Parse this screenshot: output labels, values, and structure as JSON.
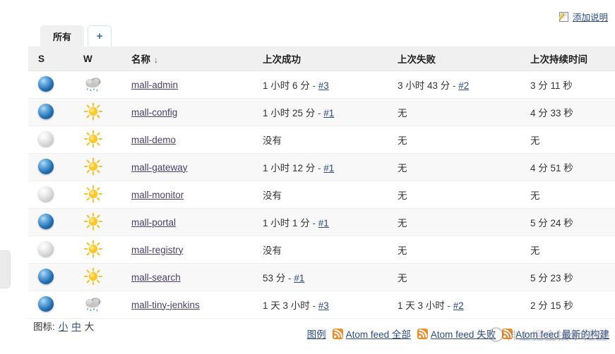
{
  "header": {
    "add_description": "添加说明",
    "add_description_icon": "pencil-edit-icon"
  },
  "tabs": {
    "items": [
      {
        "label": "所有",
        "active": true
      },
      {
        "label": "+",
        "active": false
      }
    ]
  },
  "table": {
    "columns": {
      "status": "S",
      "weather": "W",
      "name": "名称",
      "sort_arrow": "↓",
      "last_success": "上次成功",
      "last_failure": "上次失败",
      "last_duration": "上次持续时间",
      "actions": ""
    },
    "rows": [
      {
        "status": "blue",
        "status_icon": "status-ball-blue",
        "weather": "rainy",
        "weather_icon": "weather-rainy-icon",
        "name": "mall-admin",
        "last_success_text": "1 小时 6 分",
        "last_success_sep": "-",
        "last_success_build": "#3",
        "last_failure_text": "3 小时 43 分",
        "last_failure_sep": "-",
        "last_failure_build": "#2",
        "last_duration": "3 分 11 秒",
        "action_icon": "build-now-icon"
      },
      {
        "status": "blue",
        "status_icon": "status-ball-blue",
        "weather": "sunny",
        "weather_icon": "weather-sunny-icon",
        "name": "mall-config",
        "last_success_text": "1 小时 25 分",
        "last_success_sep": "-",
        "last_success_build": "#1",
        "last_failure_text": "无",
        "last_failure_sep": "",
        "last_failure_build": "",
        "last_duration": "4 分 33 秒",
        "action_icon": "build-now-icon"
      },
      {
        "status": "grey",
        "status_icon": "status-ball-grey",
        "weather": "sunny",
        "weather_icon": "weather-sunny-icon",
        "name": "mall-demo",
        "last_success_text": "没有",
        "last_success_sep": "",
        "last_success_build": "",
        "last_failure_text": "无",
        "last_failure_sep": "",
        "last_failure_build": "",
        "last_duration": "无",
        "action_icon": "build-now-icon"
      },
      {
        "status": "blue",
        "status_icon": "status-ball-blue",
        "weather": "sunny",
        "weather_icon": "weather-sunny-icon",
        "name": "mall-gateway",
        "last_success_text": "1 小时 12 分",
        "last_success_sep": "-",
        "last_success_build": "#1",
        "last_failure_text": "无",
        "last_failure_sep": "",
        "last_failure_build": "",
        "last_duration": "4 分 51 秒",
        "action_icon": "build-now-icon"
      },
      {
        "status": "grey",
        "status_icon": "status-ball-grey",
        "weather": "sunny",
        "weather_icon": "weather-sunny-icon",
        "name": "mall-monitor",
        "last_success_text": "没有",
        "last_success_sep": "",
        "last_success_build": "",
        "last_failure_text": "无",
        "last_failure_sep": "",
        "last_failure_build": "",
        "last_duration": "无",
        "action_icon": "build-now-icon"
      },
      {
        "status": "blue",
        "status_icon": "status-ball-blue",
        "weather": "sunny",
        "weather_icon": "weather-sunny-icon",
        "name": "mall-portal",
        "last_success_text": "1 小时 1 分",
        "last_success_sep": "-",
        "last_success_build": "#1",
        "last_failure_text": "无",
        "last_failure_sep": "",
        "last_failure_build": "",
        "last_duration": "5 分 24 秒",
        "action_icon": "build-now-icon"
      },
      {
        "status": "grey",
        "status_icon": "status-ball-grey",
        "weather": "sunny",
        "weather_icon": "weather-sunny-icon",
        "name": "mall-registry",
        "last_success_text": "没有",
        "last_success_sep": "",
        "last_success_build": "",
        "last_failure_text": "无",
        "last_failure_sep": "",
        "last_failure_build": "",
        "last_duration": "无",
        "action_icon": "build-now-icon"
      },
      {
        "status": "blue",
        "status_icon": "status-ball-blue",
        "weather": "sunny",
        "weather_icon": "weather-sunny-icon",
        "name": "mall-search",
        "last_success_text": "53 分",
        "last_success_sep": "-",
        "last_success_build": "#1",
        "last_failure_text": "无",
        "last_failure_sep": "",
        "last_failure_build": "",
        "last_duration": "5 分 23 秒",
        "action_icon": "build-now-icon"
      },
      {
        "status": "blue",
        "status_icon": "status-ball-blue",
        "weather": "rainy",
        "weather_icon": "weather-rainy-icon",
        "name": "mall-tiny-jenkins",
        "last_success_text": "1 天 3 小时",
        "last_success_sep": "-",
        "last_success_build": "#3",
        "last_failure_text": "1 天 3 小时",
        "last_failure_sep": "-",
        "last_failure_build": "#2",
        "last_duration": "2 分 15 秒",
        "action_icon": "build-now-icon"
      }
    ]
  },
  "footer": {
    "icon_size_label": "图标:",
    "size_small": "小",
    "size_medium": "中",
    "size_large": "大",
    "legend": "图例",
    "feed_all": "Atom feed 全部",
    "feed_failed": "Atom feed 失败",
    "feed_latest": "Atom feed 最新的构建",
    "rss_icon": "rss-feed-icon"
  },
  "watermark": {
    "text": "神上掘金技术社区"
  },
  "colors": {
    "link": "#2b4a86",
    "job_link": "#4a3f6b",
    "header_bg": "#f0f0f0",
    "row_alt": "#f8f8f8",
    "rss_orange": "#f08a24",
    "status_blue": "#1f6cb0",
    "status_grey": "#d2d2d2"
  }
}
